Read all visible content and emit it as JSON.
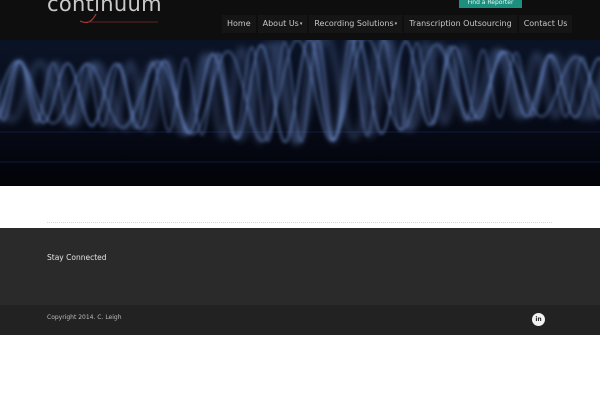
{
  "header": {
    "logo_text": "continuum",
    "cta_label": "Find a Reporter",
    "nav": [
      {
        "label": "Home",
        "has_dropdown": false
      },
      {
        "label": "About Us",
        "has_dropdown": true
      },
      {
        "label": "Recording Solutions",
        "has_dropdown": true
      },
      {
        "label": "Transcription Outsourcing",
        "has_dropdown": false
      },
      {
        "label": "Contact Us",
        "has_dropdown": false
      }
    ],
    "dropdown_glyph": "▾"
  },
  "hero": {
    "image": "blue-audio-waveform-image"
  },
  "footer": {
    "stay_connected": "Stay Connected",
    "copyright": "Copyright 2014. C. Leigh",
    "social": {
      "icon": "linkedin-icon",
      "label": "in"
    }
  },
  "colors": {
    "header_bg": "#0e0e0e",
    "cta_bg": "#1d8f7f",
    "wave": "#6f8fd0",
    "footer_top_bg": "#2a2a2a",
    "footer_bottom_bg": "#222222"
  }
}
